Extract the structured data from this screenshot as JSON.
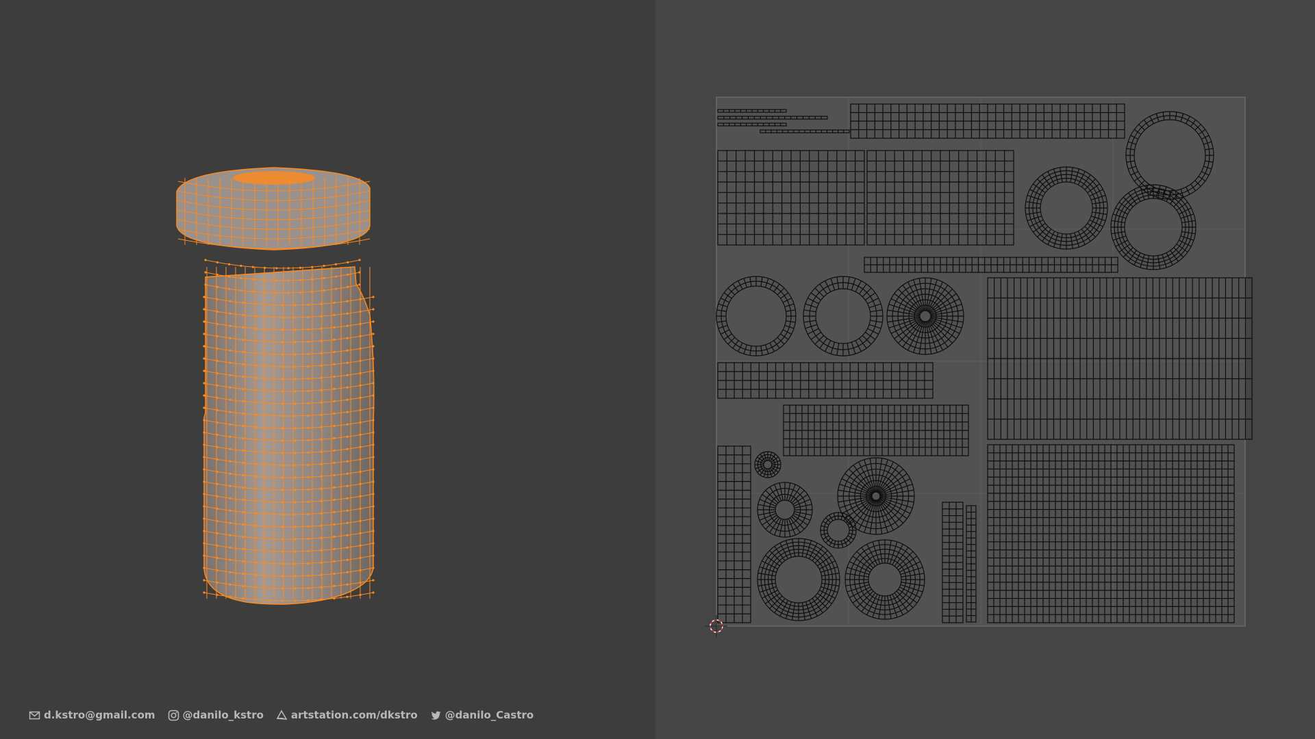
{
  "viewport": {
    "object": "bottle",
    "mesh_fill": "#8e8580",
    "wire_color": "#ff8a1c"
  },
  "uv_editor": {
    "grid_color": "#5a5a5a",
    "island_color": "#0d0d0d",
    "cursor": "2d-cursor-icon"
  },
  "footer": {
    "email": "d.kstro@gmail.com",
    "instagram": "@danilo_kstro",
    "artstation": "artstation.com/dkstro",
    "twitter": "@danilo_Castro"
  },
  "icons": {
    "email": "envelope-icon",
    "instagram": "instagram-icon",
    "artstation": "artstation-icon",
    "twitter": "twitter-icon"
  }
}
